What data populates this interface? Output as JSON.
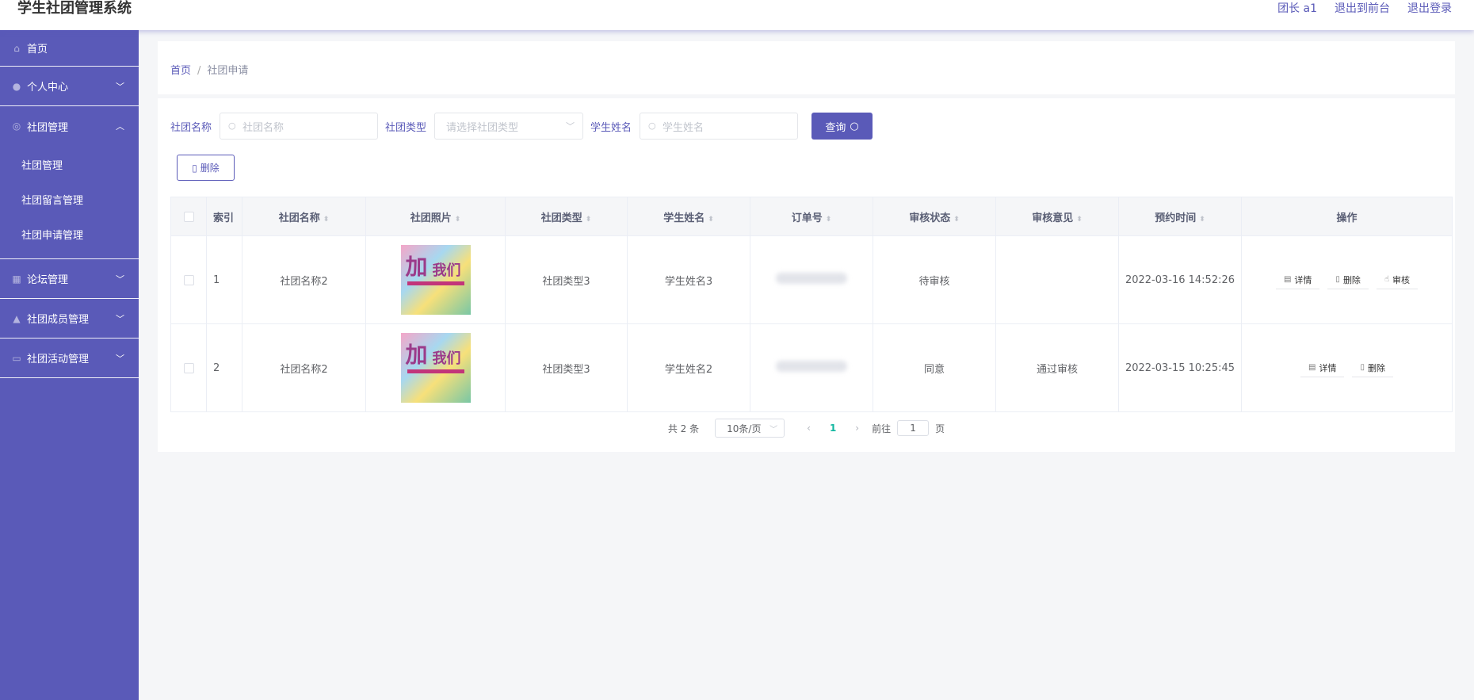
{
  "app_title": "学生社团管理系统",
  "top_links": [
    "团长 a1",
    "退出到前台",
    "退出登录"
  ],
  "sidebar": {
    "items": [
      {
        "label": "首页",
        "icon": "home-icon"
      },
      {
        "label": "个人中心",
        "icon": "user-icon"
      },
      {
        "label": "社团管理",
        "icon": "club-icon"
      },
      {
        "label": "论坛管理",
        "icon": "grid-icon"
      },
      {
        "label": "社团成员管理",
        "icon": "members-icon"
      },
      {
        "label": "社团活动管理",
        "icon": "chat-icon"
      }
    ],
    "submenu": [
      "社团管理",
      "社团留言管理",
      "社团申请管理"
    ]
  },
  "breadcrumb": {
    "home": "首页",
    "separator": "/",
    "current": "社团申请"
  },
  "search": {
    "club_name_label": "社团名称",
    "club_name_placeholder": "社团名称",
    "club_type_label": "社团类型",
    "club_type_placeholder": "请选择社团类型",
    "student_name_label": "学生姓名",
    "student_name_placeholder": "学生姓名",
    "query_button": "查询"
  },
  "delete_button": "删除",
  "table": {
    "headers": [
      "索引",
      "社团名称",
      "社团照片",
      "社团类型",
      "学生姓名",
      "订单号",
      "审核状态",
      "审核意见",
      "预约时间",
      "操作"
    ],
    "rows": [
      {
        "index": "1",
        "club_name": "社团名称2",
        "photo_text_a": "加",
        "photo_text_b": "我们",
        "club_type": "社团类型3",
        "student_name": "学生姓名3",
        "status": "待审核",
        "opinion": "",
        "time": "2022-03-16 14:52:26",
        "actions": [
          "详情",
          "删除",
          "审核"
        ]
      },
      {
        "index": "2",
        "club_name": "社团名称2",
        "photo_text_a": "加",
        "photo_text_b": "我们",
        "club_type": "社团类型3",
        "student_name": "学生姓名2",
        "status": "同意",
        "opinion": "通过审核",
        "time": "2022-03-15 10:25:45",
        "actions": [
          "详情",
          "删除"
        ]
      }
    ]
  },
  "pagination": {
    "total": "共 2 条",
    "page_size": "10条/页",
    "current_page": "1",
    "goto_label": "前往",
    "goto_value": "1",
    "page_unit": "页"
  },
  "colors": {
    "primary": "#5a5ab8",
    "active_page": "#11b7a0"
  }
}
